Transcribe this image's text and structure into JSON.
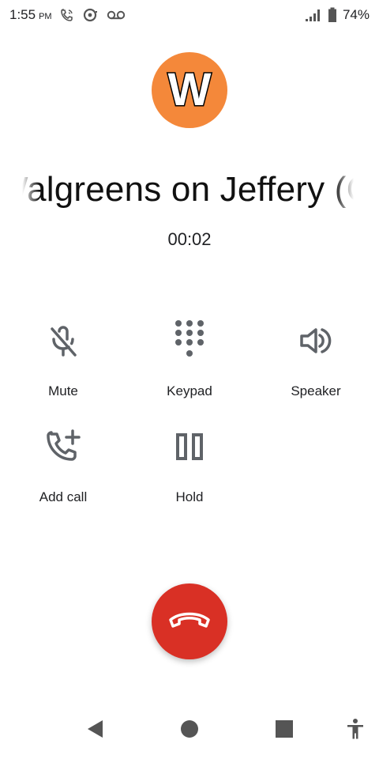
{
  "status_bar": {
    "time": "1:55",
    "ampm": "PM",
    "battery_percent": "74%",
    "icons": [
      "wifi-calling-icon",
      "sync-icon",
      "voicemail-icon",
      "signal-icon",
      "battery-icon"
    ]
  },
  "contact": {
    "avatar_letter": "W",
    "avatar_color": "#f4883a",
    "name": "Walgreens on Jeffery (C"
  },
  "call": {
    "timer": "00:02"
  },
  "controls": {
    "mute_label": "Mute",
    "keypad_label": "Keypad",
    "speaker_label": "Speaker",
    "add_call_label": "Add call",
    "hold_label": "Hold"
  },
  "end_call": {
    "color": "#d93025",
    "icon": "hang-up-icon"
  },
  "nav_bar": {
    "icons": [
      "back-icon",
      "home-icon",
      "recents-icon",
      "accessibility-icon"
    ]
  }
}
